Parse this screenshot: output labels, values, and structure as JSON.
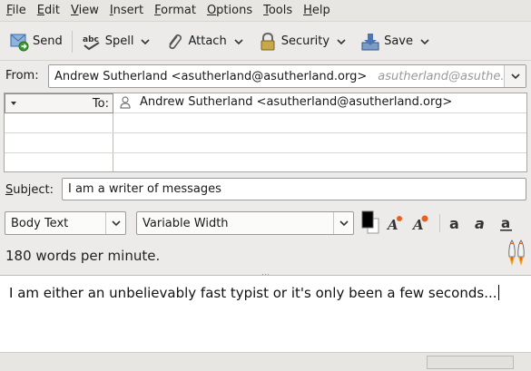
{
  "menubar": {
    "items": [
      {
        "underline": "F",
        "rest": "ile"
      },
      {
        "underline": "E",
        "rest": "dit"
      },
      {
        "underline": "V",
        "rest": "iew"
      },
      {
        "underline": "I",
        "rest": "nsert"
      },
      {
        "underline": "F",
        "rest": "ormat"
      },
      {
        "underline": "O",
        "rest": "ptions"
      },
      {
        "underline": "T",
        "rest": "ools"
      },
      {
        "underline": "H",
        "rest": "elp"
      }
    ]
  },
  "toolbar": {
    "send_label": "Send",
    "spell_label": "Spell",
    "attach_label": "Attach",
    "security_label": "Security",
    "save_label": "Save"
  },
  "from": {
    "label": "From:",
    "value": "Andrew Sutherland <asutherland@asutherland.org>",
    "hint": "asutherland@asuthe..."
  },
  "addressing": {
    "type_label": "To:",
    "recipient": "Andrew Sutherland <asutherland@asutherland.org>"
  },
  "subject": {
    "label": "Subject:",
    "value": "I am a writer of messages"
  },
  "format": {
    "paragraph_style": "Body Text",
    "font": "Variable Width",
    "text_color": "#000000",
    "background_color": "#ffffff"
  },
  "status": {
    "wpm_text": "180 words per minute."
  },
  "body": {
    "text": "I am either an unbelievably fast typist or it's only been a few seconds..."
  },
  "colors": {
    "window_bg": "#ecebea",
    "accent_rocket": "#e8611e"
  }
}
